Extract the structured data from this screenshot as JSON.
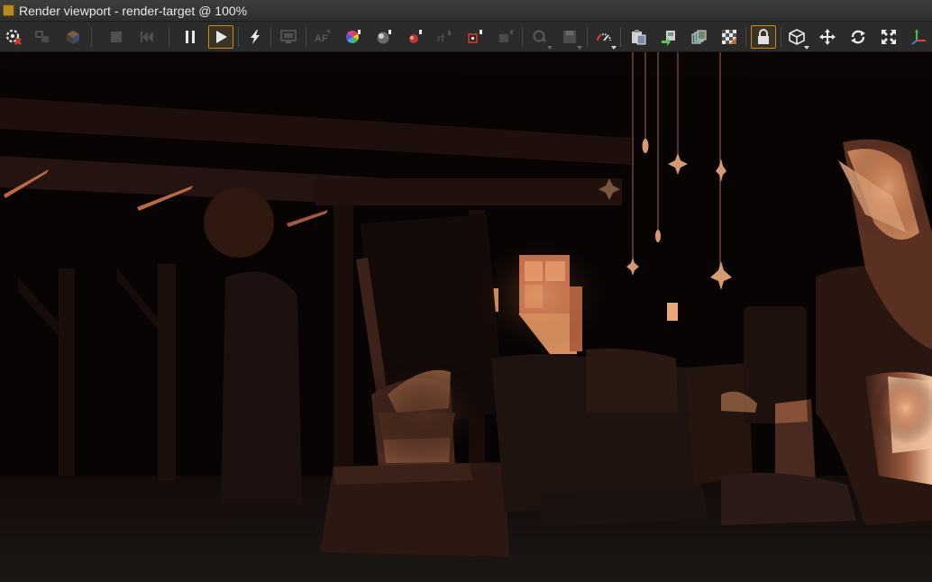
{
  "window": {
    "title": "Render viewport - render-target @ 100%"
  },
  "toolbar": {
    "buttons": [
      {
        "name": "render-settings-button",
        "icon": "render-settings-icon"
      },
      {
        "name": "region-render-button",
        "icon": "region-render-icon"
      },
      {
        "name": "object-render-button",
        "icon": "cube-render-icon"
      },
      {
        "name": "stop-render-button",
        "icon": "stop-icon"
      },
      {
        "name": "restart-render-button",
        "icon": "skip-back-icon"
      },
      {
        "name": "pause-render-button",
        "icon": "pause-icon"
      },
      {
        "name": "start-render-button",
        "icon": "play-icon",
        "active": true
      },
      {
        "name": "quick-render-button",
        "icon": "lightning-icon"
      },
      {
        "name": "display-mode-button",
        "icon": "monitor-icon"
      },
      {
        "name": "auto-focus-button",
        "icon": "af-icon"
      },
      {
        "name": "color-picker-button",
        "icon": "color-wheel-icon"
      },
      {
        "name": "material-picker-button",
        "icon": "material-sphere-icon"
      },
      {
        "name": "light-picker-button",
        "icon": "light-picker-icon"
      },
      {
        "name": "refocus-button",
        "icon": "refocus-icon"
      },
      {
        "name": "object-picker-button",
        "icon": "object-picker-icon"
      },
      {
        "name": "mesh-picker-button",
        "icon": "mesh-picker-icon"
      },
      {
        "name": "zoom-button",
        "icon": "zoom-icon"
      },
      {
        "name": "save-image-button",
        "icon": "save-icon"
      },
      {
        "name": "performance-button",
        "icon": "gauge-icon"
      },
      {
        "name": "copy-to-clipboard-button",
        "icon": "clipboard-icon"
      },
      {
        "name": "export-button",
        "icon": "export-icon"
      },
      {
        "name": "layers-button",
        "icon": "layers-icon"
      },
      {
        "name": "alpha-button",
        "icon": "checker-icon"
      },
      {
        "name": "lock-button",
        "icon": "lock-icon",
        "active": true
      },
      {
        "name": "camera-view-button",
        "icon": "cube-icon"
      },
      {
        "name": "pan-button",
        "icon": "move-icon"
      },
      {
        "name": "orbit-button",
        "icon": "rotate-icon"
      },
      {
        "name": "fit-view-button",
        "icon": "fullscreen-icon"
      },
      {
        "name": "gizmo-button",
        "icon": "axis-gizmo-icon"
      }
    ]
  },
  "colors": {
    "accent": "#c98a1b",
    "toolbar_bg": "#2b2b2b",
    "titlebar_bg": "#383838",
    "warm_light": "#e79f6c"
  },
  "viewport": {
    "image_semantic": "dimly lit barn interior render with covered furniture, hanging star ornaments and warm window light"
  }
}
